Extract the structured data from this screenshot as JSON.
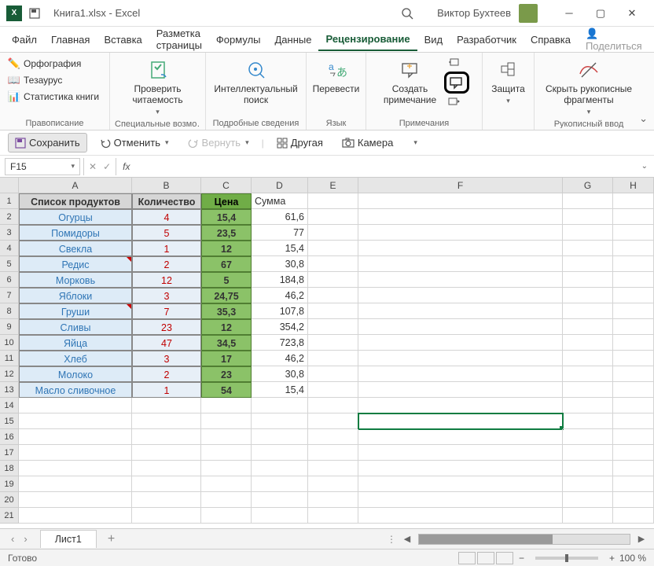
{
  "titlebar": {
    "filename": "Книга1.xlsx  -  Excel",
    "username": "Виктор Бухтеев"
  },
  "menu": {
    "tabs": [
      "Файл",
      "Главная",
      "Вставка",
      "Разметка страницы",
      "Формулы",
      "Данные",
      "Рецензирование",
      "Вид",
      "Разработчик",
      "Справка"
    ],
    "active": "Рецензирование",
    "share": "Поделиться"
  },
  "ribbon": {
    "g1": {
      "label": "Правописание",
      "spelling": "Орфография",
      "thesaurus": "Тезаурус",
      "stats": "Статистика книги"
    },
    "g2": {
      "label": "Специальные возмо…",
      "check": "Проверить\nчитаемость"
    },
    "g3": {
      "label": "Подробные сведения",
      "smart": "Интеллектуальный\nпоиск"
    },
    "g4": {
      "label": "Язык",
      "translate": "Перевести"
    },
    "g5": {
      "label": "Примечания",
      "newc": "Создать\nпримечание"
    },
    "g6": {
      "label": "",
      "protect": "Защита"
    },
    "g7": {
      "label": "Рукописный ввод",
      "ink": "Скрыть рукописные\nфрагменты"
    }
  },
  "quick": {
    "save": "Сохранить",
    "undo": "Отменить",
    "redo": "Вернуть",
    "other": "Другая",
    "camera": "Камера"
  },
  "formula": {
    "cellref": "F15"
  },
  "cols": [
    "A",
    "B",
    "C",
    "D",
    "E",
    "F",
    "G",
    "H"
  ],
  "headers": {
    "a": "Список продуктов",
    "b": "Количество",
    "c": "Цена",
    "d": "Сумма"
  },
  "rows": [
    {
      "a": "Огурцы",
      "b": "4",
      "c": "15,4",
      "d": "61,6",
      "cm": false
    },
    {
      "a": "Помидоры",
      "b": "5",
      "c": "23,5",
      "d": "77",
      "cm": false
    },
    {
      "a": "Свекла",
      "b": "1",
      "c": "12",
      "d": "15,4",
      "cm": false
    },
    {
      "a": "Редис",
      "b": "2",
      "c": "67",
      "d": "30,8",
      "cm": true
    },
    {
      "a": "Морковь",
      "b": "12",
      "c": "5",
      "d": "184,8",
      "cm": false
    },
    {
      "a": "Яблоки",
      "b": "3",
      "c": "24,75",
      "d": "46,2",
      "cm": false
    },
    {
      "a": "Груши",
      "b": "7",
      "c": "35,3",
      "d": "107,8",
      "cm": true
    },
    {
      "a": "Сливы",
      "b": "23",
      "c": "12",
      "d": "354,2",
      "cm": false
    },
    {
      "a": "Яйца",
      "b": "47",
      "c": "34,5",
      "d": "723,8",
      "cm": false
    },
    {
      "a": "Хлеб",
      "b": "3",
      "c": "17",
      "d": "46,2",
      "cm": false
    },
    {
      "a": "Молоко",
      "b": "2",
      "c": "23",
      "d": "30,8",
      "cm": false
    },
    {
      "a": "Масло сливочное",
      "b": "1",
      "c": "54",
      "d": "15,4",
      "cm": false
    }
  ],
  "sheet": {
    "name": "Лист1"
  },
  "status": {
    "ready": "Готово",
    "zoom": "100 %"
  }
}
